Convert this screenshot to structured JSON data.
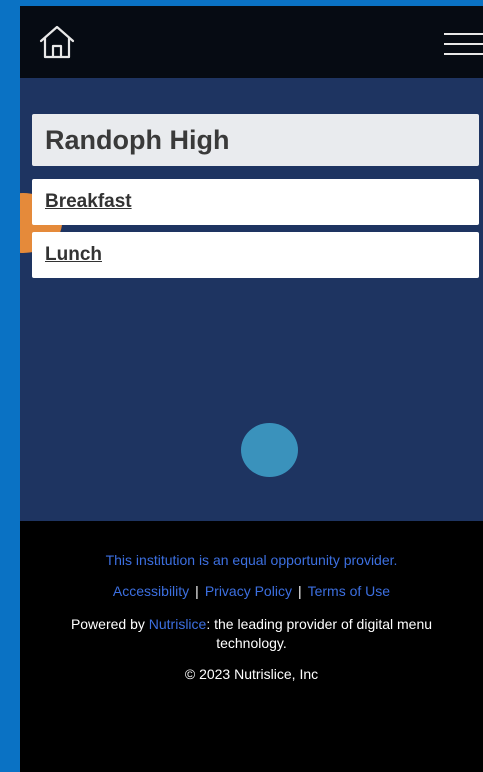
{
  "header": {
    "home_icon": "home-icon",
    "menu_icon": "hamburger-menu-icon"
  },
  "main": {
    "school_name": "Randoph High",
    "menus": [
      {
        "label": "Breakfast"
      },
      {
        "label": "Lunch"
      }
    ]
  },
  "footer": {
    "equal_opportunity": "This institution is an equal opportunity provider.",
    "links": [
      {
        "label": "Accessibility"
      },
      {
        "label": "Privacy Policy"
      },
      {
        "label": "Terms of Use"
      }
    ],
    "separator": "|",
    "powered_prefix": "Powered by ",
    "powered_brand": "Nutrislice",
    "powered_suffix": ": the leading provider of digital menu technology.",
    "copyright": "© 2023 Nutrislice, Inc"
  },
  "colors": {
    "page_background": "#0a72c4",
    "header_background": "#060b13",
    "main_background": "#1e3461",
    "link_blue": "#3c6fe0",
    "accent_orange": "#e58a3a",
    "accent_blue": "#3a92bc"
  }
}
